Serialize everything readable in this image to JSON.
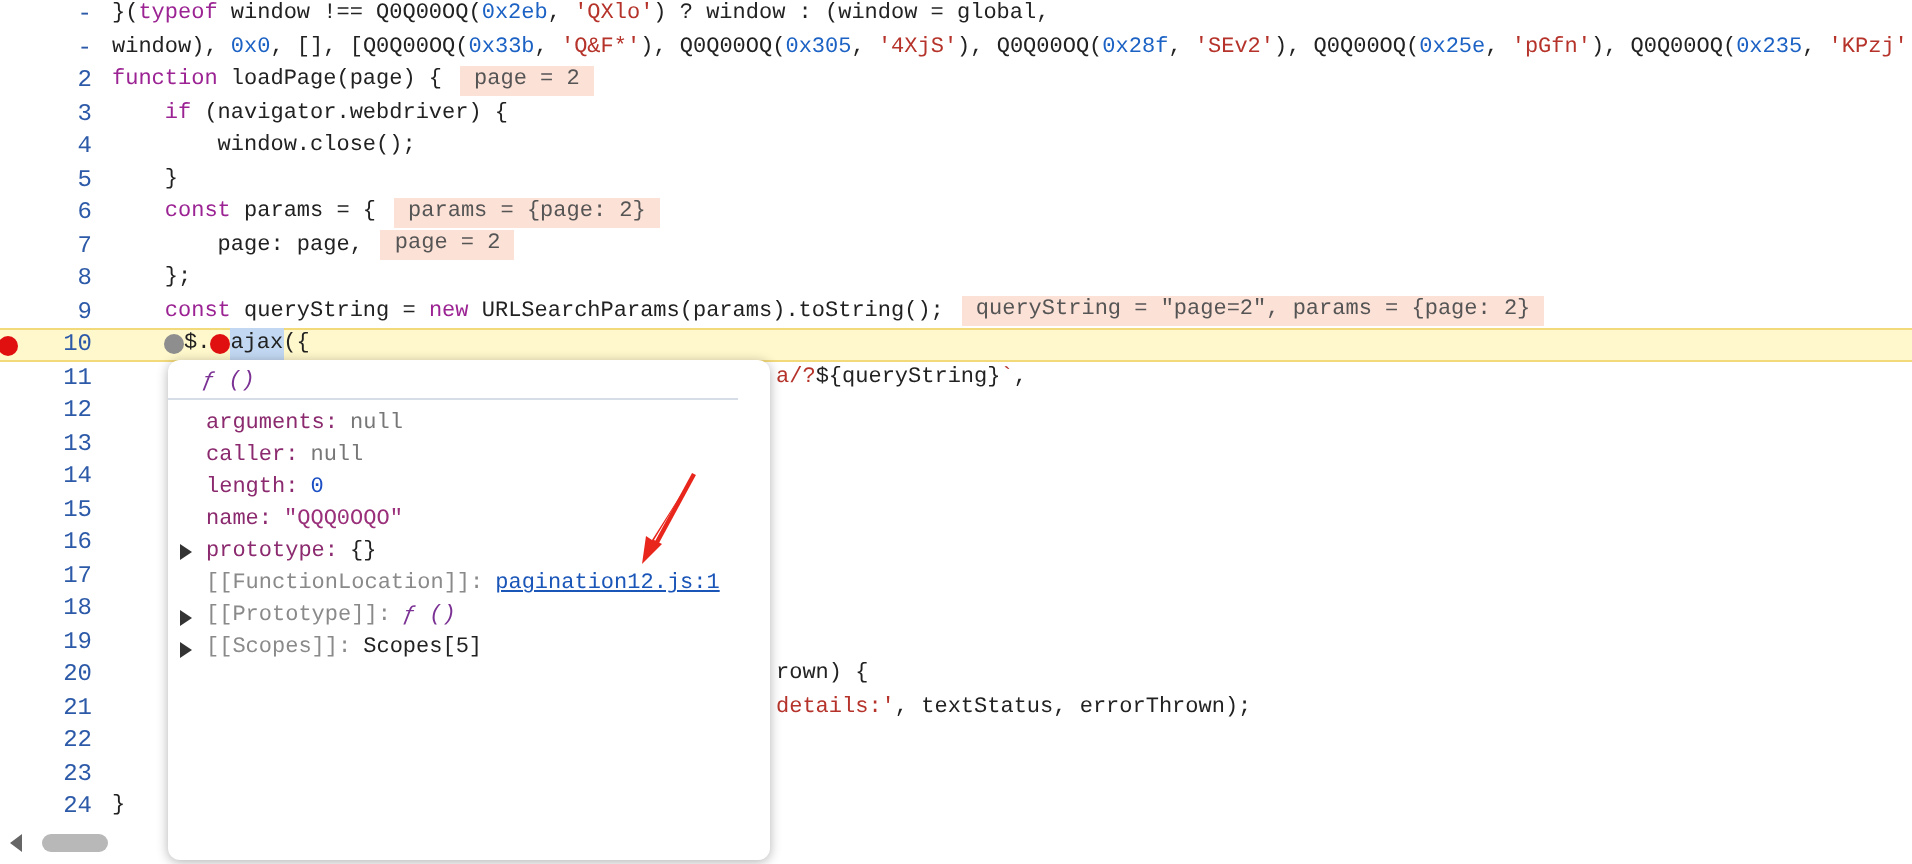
{
  "lines": [
    {
      "number": "-",
      "breakpoint": false,
      "highlighted": false,
      "covered": false,
      "segments": [
        {
          "kind": "plain",
          "text": "}("
        },
        {
          "kind": "keyword",
          "text": "typeof"
        },
        {
          "kind": "plain",
          "text": " window !== Q0Q00OQ("
        },
        {
          "kind": "number",
          "text": "0x2eb"
        },
        {
          "kind": "plain",
          "text": ", "
        },
        {
          "kind": "string",
          "text": "'QXlo'"
        },
        {
          "kind": "plain",
          "text": ") ? window : (window = global,"
        }
      ]
    },
    {
      "number": "-",
      "breakpoint": false,
      "highlighted": false,
      "covered": false,
      "segments": [
        {
          "kind": "plain",
          "text": "window), "
        },
        {
          "kind": "number",
          "text": "0x0"
        },
        {
          "kind": "plain",
          "text": ", [], [Q0Q00OQ("
        },
        {
          "kind": "number",
          "text": "0x33b"
        },
        {
          "kind": "plain",
          "text": ", "
        },
        {
          "kind": "string",
          "text": "'Q&F*'"
        },
        {
          "kind": "plain",
          "text": "), Q0Q00OQ("
        },
        {
          "kind": "number",
          "text": "0x305"
        },
        {
          "kind": "plain",
          "text": ", "
        },
        {
          "kind": "string",
          "text": "'4XjS'"
        },
        {
          "kind": "plain",
          "text": "), Q0Q00OQ("
        },
        {
          "kind": "number",
          "text": "0x28f"
        },
        {
          "kind": "plain",
          "text": ", "
        },
        {
          "kind": "string",
          "text": "'SEv2'"
        },
        {
          "kind": "plain",
          "text": "), Q0Q00OQ("
        },
        {
          "kind": "number",
          "text": "0x25e"
        },
        {
          "kind": "plain",
          "text": ", "
        },
        {
          "kind": "string",
          "text": "'pGfn'"
        },
        {
          "kind": "plain",
          "text": "), Q0Q00OQ("
        },
        {
          "kind": "number",
          "text": "0x235"
        },
        {
          "kind": "plain",
          "text": ", "
        },
        {
          "kind": "string",
          "text": "'KPzj'"
        }
      ]
    },
    {
      "number": "2",
      "breakpoint": false,
      "highlighted": false,
      "covered": false,
      "segments": [
        {
          "kind": "keyword",
          "text": "function"
        },
        {
          "kind": "plain",
          "text": " loadPage(page) {"
        },
        {
          "kind": "value",
          "text": "page = 2"
        }
      ]
    },
    {
      "number": "3",
      "breakpoint": false,
      "highlighted": false,
      "covered": false,
      "segments": [
        {
          "kind": "keyword",
          "text": "    if"
        },
        {
          "kind": "plain",
          "text": " (navigator.webdriver) {"
        }
      ]
    },
    {
      "number": "4",
      "breakpoint": false,
      "highlighted": false,
      "covered": false,
      "segments": [
        {
          "kind": "plain",
          "text": "        window.close();"
        }
      ]
    },
    {
      "number": "5",
      "breakpoint": false,
      "highlighted": false,
      "covered": false,
      "segments": [
        {
          "kind": "plain",
          "text": "    }"
        }
      ]
    },
    {
      "number": "6",
      "breakpoint": false,
      "highlighted": false,
      "covered": false,
      "segments": [
        {
          "kind": "keyword",
          "text": "    const"
        },
        {
          "kind": "plain",
          "text": " params = {"
        },
        {
          "kind": "value",
          "text": "params = {page: 2}"
        }
      ]
    },
    {
      "number": "7",
      "breakpoint": false,
      "highlighted": false,
      "covered": false,
      "segments": [
        {
          "kind": "plain",
          "text": "        page: page,"
        },
        {
          "kind": "value",
          "text": "page = 2"
        }
      ]
    },
    {
      "number": "8",
      "breakpoint": false,
      "highlighted": false,
      "covered": false,
      "segments": [
        {
          "kind": "plain",
          "text": "    };"
        }
      ]
    },
    {
      "number": "9",
      "breakpoint": false,
      "highlighted": false,
      "covered": false,
      "segments": [
        {
          "kind": "keyword",
          "text": "    const"
        },
        {
          "kind": "plain",
          "text": " queryString = "
        },
        {
          "kind": "keyword",
          "text": "new"
        },
        {
          "kind": "plain",
          "text": " URLSearchParams(params).toString();"
        },
        {
          "kind": "value",
          "text": "queryString = \"page=2\", params = {page: 2}"
        }
      ]
    },
    {
      "number": "10",
      "breakpoint": true,
      "highlighted": true,
      "covered": false,
      "segments": [
        {
          "kind": "marker",
          "enabled": false
        },
        {
          "kind": "plain",
          "text": "$."
        },
        {
          "kind": "marker",
          "enabled": true
        },
        {
          "kind": "selection",
          "text": "ajax"
        },
        {
          "kind": "plain",
          "text": "({"
        }
      ]
    },
    {
      "number": "11",
      "breakpoint": false,
      "highlighted": false,
      "covered": true,
      "segments": [
        {
          "kind": "string",
          "text": "a/?"
        },
        {
          "kind": "plain",
          "text": "${queryString}"
        },
        {
          "kind": "string",
          "text": "`"
        },
        {
          "kind": "plain",
          "text": ","
        }
      ]
    },
    {
      "number": "12",
      "breakpoint": false,
      "highlighted": false
    },
    {
      "number": "13",
      "breakpoint": false,
      "highlighted": false
    },
    {
      "number": "14",
      "breakpoint": false,
      "highlighted": false
    },
    {
      "number": "15",
      "breakpoint": false,
      "highlighted": false
    },
    {
      "number": "16",
      "breakpoint": false,
      "highlighted": false
    },
    {
      "number": "17",
      "breakpoint": false,
      "highlighted": false
    },
    {
      "number": "18",
      "breakpoint": false,
      "highlighted": false
    },
    {
      "number": "19",
      "breakpoint": false,
      "highlighted": false
    },
    {
      "number": "20",
      "breakpoint": false,
      "highlighted": false,
      "covered": true,
      "segments": [
        {
          "kind": "plain",
          "text": "rown) {"
        }
      ]
    },
    {
      "number": "21",
      "breakpoint": false,
      "highlighted": false,
      "covered": true,
      "segments": [
        {
          "kind": "string",
          "text": "details:'"
        },
        {
          "kind": "plain",
          "text": ", textStatus, errorThrown);"
        }
      ]
    },
    {
      "number": "22",
      "breakpoint": false,
      "highlighted": false
    },
    {
      "number": "23",
      "breakpoint": false,
      "highlighted": false
    },
    {
      "number": "24",
      "breakpoint": false,
      "highlighted": false,
      "covered": false,
      "segments": [
        {
          "kind": "plain",
          "text": "}"
        }
      ]
    }
  ],
  "popover": {
    "header": "ƒ ()",
    "properties": [
      {
        "key": "arguments:",
        "value": "null",
        "kind": "null",
        "internal": false,
        "expandable": false
      },
      {
        "key": "caller:",
        "value": "null",
        "kind": "null",
        "internal": false,
        "expandable": false
      },
      {
        "key": "length:",
        "value": "0",
        "kind": "number",
        "internal": false,
        "expandable": false
      },
      {
        "key": "name:",
        "value": "\"QQQ0OQO\"",
        "kind": "string",
        "internal": false,
        "expandable": false
      },
      {
        "key": "prototype:",
        "value": "{}",
        "kind": "plain",
        "internal": false,
        "expandable": true
      },
      {
        "key": "[[FunctionLocation]]:",
        "value": "pagination12.js:1",
        "kind": "link",
        "internal": true,
        "expandable": false
      },
      {
        "key": "[[Prototype]]:",
        "value": "ƒ ()",
        "kind": "function",
        "internal": true,
        "expandable": true
      },
      {
        "key": "[[Scopes]]:",
        "value": "Scopes[5]",
        "kind": "plain",
        "internal": true,
        "expandable": true
      }
    ]
  }
}
